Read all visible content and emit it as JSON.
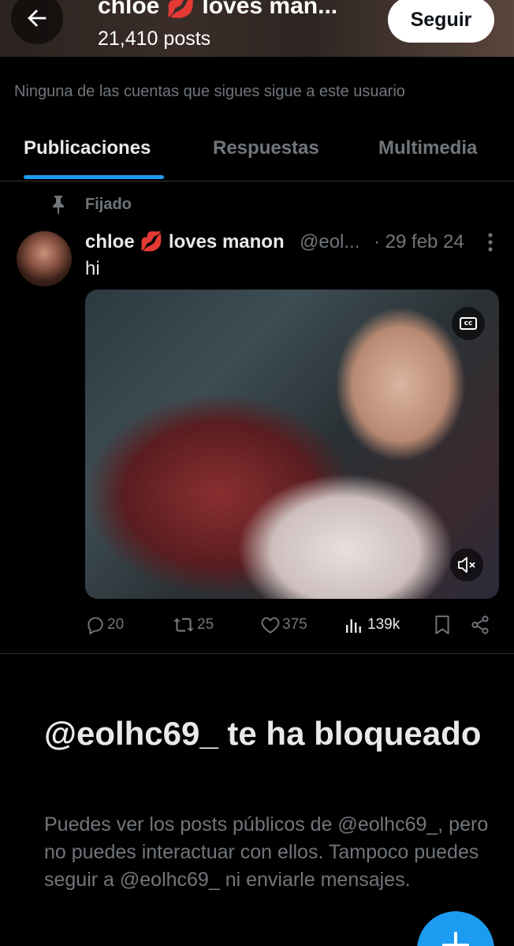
{
  "header": {
    "name": "chloe 💋 loves man...",
    "post_count": "21,410 posts",
    "follow_label": "Seguir"
  },
  "follow_note": "Ninguna de las cuentas que sigues sigue a este usuario",
  "tabs": [
    {
      "label": "Publicaciones",
      "active": true
    },
    {
      "label": "Respuestas",
      "active": false
    },
    {
      "label": "Multimedia",
      "active": false
    }
  ],
  "pinned_label": "Fijado",
  "post": {
    "author_name": "chloe 💋 loves manon",
    "handle": "@eol...",
    "date": "· 29 feb 24",
    "text": "hi",
    "replies": "20",
    "reposts": "25",
    "likes": "375",
    "views": "139k"
  },
  "blocked": {
    "title": "@eolhc69_ te ha bloqueado",
    "body": "Puedes ver los posts públicos de @eolhc69_, pero no puedes interactuar con ellos. Tampoco puedes seguir a @eolhc69_ ni enviarle mensajes."
  },
  "colors": {
    "accent": "#1d9bf0",
    "muted_text": "#71767b",
    "primary_text": "#e7e9ea",
    "background": "#000000"
  },
  "icons": [
    "back-arrow-icon",
    "pin-icon",
    "more-icon",
    "captions-icon",
    "mute-icon",
    "reply-icon",
    "repost-icon",
    "like-icon",
    "views-icon",
    "bookmark-icon",
    "share-icon",
    "compose-icon"
  ]
}
